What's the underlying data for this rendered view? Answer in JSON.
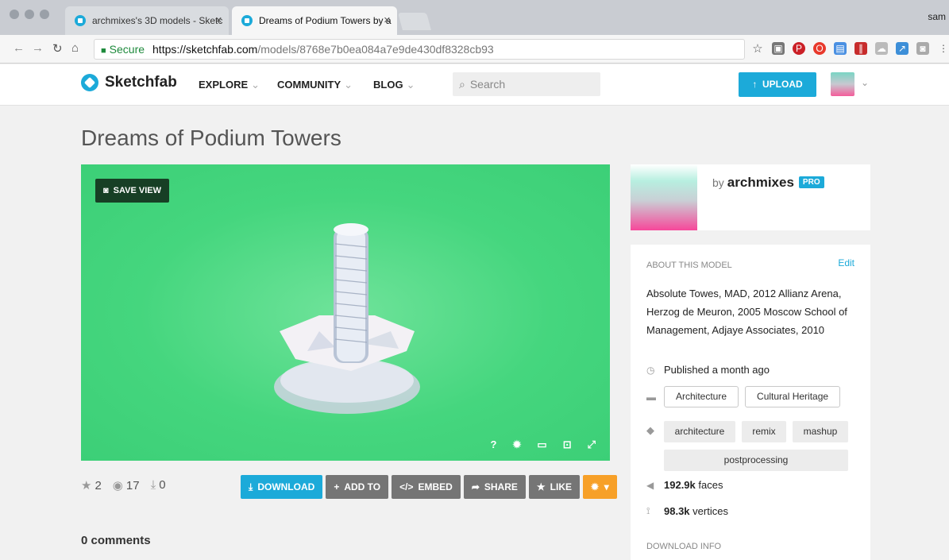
{
  "browser": {
    "tabs": [
      {
        "title": "archmixes's 3D models - Sketc",
        "active": false
      },
      {
        "title": "Dreams of Podium Towers by a",
        "active": true
      }
    ],
    "user": "sam",
    "url": {
      "secure_label": "Secure",
      "host": "https://sketchfab.com",
      "path": "/models/8768e7b0ea084a7e9de430df8328cb93"
    }
  },
  "header": {
    "logo": "Sketchfab",
    "nav": [
      "EXPLORE",
      "COMMUNITY",
      "BLOG"
    ],
    "search_placeholder": "Search",
    "upload_label": "UPLOAD"
  },
  "model": {
    "title": "Dreams of Podium Towers",
    "save_view_label": "SAVE VIEW",
    "viewer_controls": [
      "help-icon",
      "settings-icon",
      "vr-icon",
      "embed-icon",
      "fullscreen-icon"
    ]
  },
  "stats": {
    "likes": "2",
    "views": "17",
    "downloads": "0"
  },
  "actions": {
    "download": "DOWNLOAD",
    "add_to": "ADD TO",
    "embed": "EMBED",
    "share": "SHARE",
    "like": "LIKE"
  },
  "comments": "0 comments",
  "author": {
    "by": "by",
    "name": "archmixes",
    "badge": "PRO"
  },
  "about": {
    "heading": "ABOUT THIS MODEL",
    "edit": "Edit",
    "description": "Absolute Towes, MAD, 2012 Allianz Arena, Herzog de Meuron, 2005 Moscow School of Management, Adjaye Associates, 2010",
    "published": "Published a month ago",
    "categories": [
      "Architecture",
      "Cultural Heritage"
    ],
    "tags": [
      "architecture",
      "remix",
      "mashup",
      "postprocessing"
    ],
    "faces": "192.9k",
    "faces_label": "faces",
    "vertices": "98.3k",
    "vertices_label": "vertices",
    "download_heading": "DOWNLOAD INFO"
  },
  "colors": {
    "accent": "#1caad9",
    "viewer_bg": "#45d67e",
    "like_orange": "#f7a028",
    "button_gray": "#757575"
  }
}
